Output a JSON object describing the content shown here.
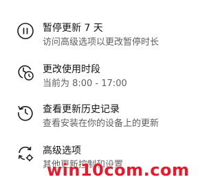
{
  "options": {
    "pause": {
      "icon": "pause-circle-icon",
      "title": "暂停更新 7 天",
      "description": "访问高级选项以更改暂停时长"
    },
    "active_hours": {
      "icon": "clock-schedule-icon",
      "title": "更改使用时段",
      "description": "当前为 8:00 - 17:00"
    },
    "history": {
      "icon": "history-icon",
      "title": "查看更新历史记录",
      "description": "查看安装在你的设备上的更新"
    },
    "advanced": {
      "icon": "sync-gear-icon",
      "title": "高级选项",
      "description": "其他更新控制和设置"
    }
  },
  "watermark": {
    "text": "win10com.com",
    "color": "#e8192c"
  },
  "colors": {
    "title_text": "#111111",
    "description_text": "#5f5f5f",
    "icon_stroke": "#1a1a1a"
  }
}
